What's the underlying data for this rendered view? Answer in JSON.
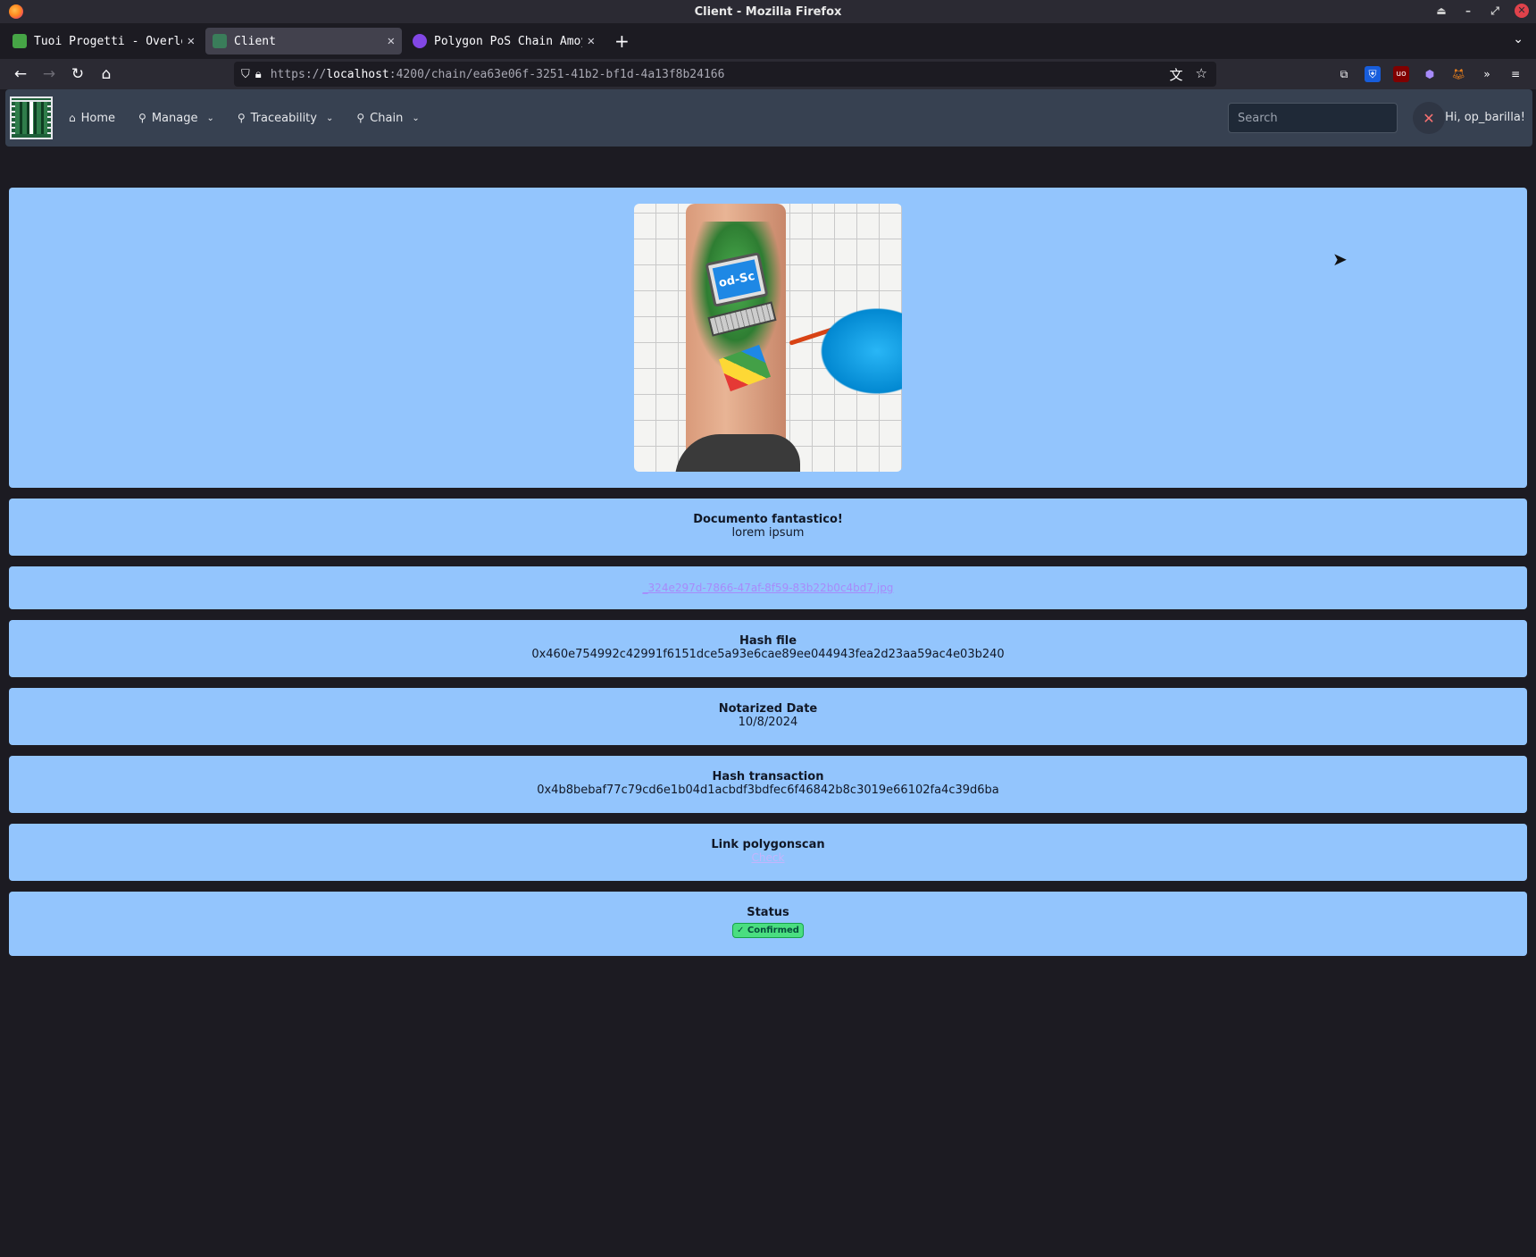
{
  "window": {
    "title": "Client - Mozilla Firefox"
  },
  "tabs": [
    {
      "title": "Tuoi Progetti - Overleaf,",
      "favicon_color": "#46a546",
      "active": false
    },
    {
      "title": "Client",
      "favicon_color": "#3a7d5a",
      "active": true
    },
    {
      "title": "Polygon PoS Chain Amoy Tr",
      "favicon_color": "#8247e5",
      "active": false
    }
  ],
  "urlbar": {
    "prefix": "https://",
    "host": "localhost",
    "rest": ":4200/chain/ea63e06f-3251-41b2-bf1d-4a13f8b24166"
  },
  "app_nav": {
    "home": "Home",
    "manage": "Manage",
    "traceability": "Traceability",
    "chain": "Chain",
    "search_placeholder": "Search",
    "greeting": "Hi, op_barilla!"
  },
  "image": {
    "screen_text": "od-Sc"
  },
  "document": {
    "title": "Documento fantastico!",
    "description": "lorem ipsum",
    "file_link": "_324e297d-7866-47af-8f59-83b22b0c4bd7.jpg",
    "hash_file_label": "Hash file",
    "hash_file": "0x460e754992c42991f6151dce5a93e6cae89ee044943fea2d23aa59ac4e03b240",
    "notarized_label": "Notarized Date",
    "notarized_date": "10/8/2024",
    "hash_tx_label": "Hash transaction",
    "hash_tx": "0x4b8bebaf77c79cd6e1b04d1acbdf3bdfec6f46842b8c3019e66102fa4c39d6ba",
    "polygonscan_label": "Link polygonscan",
    "polygonscan_link": "Check",
    "status_label": "Status",
    "status": "Confirmed"
  },
  "colors": {
    "card_bg": "#93c5fd",
    "header_bg": "#374151",
    "page_bg": "#1c1b22",
    "status_badge": "#4ade80"
  }
}
